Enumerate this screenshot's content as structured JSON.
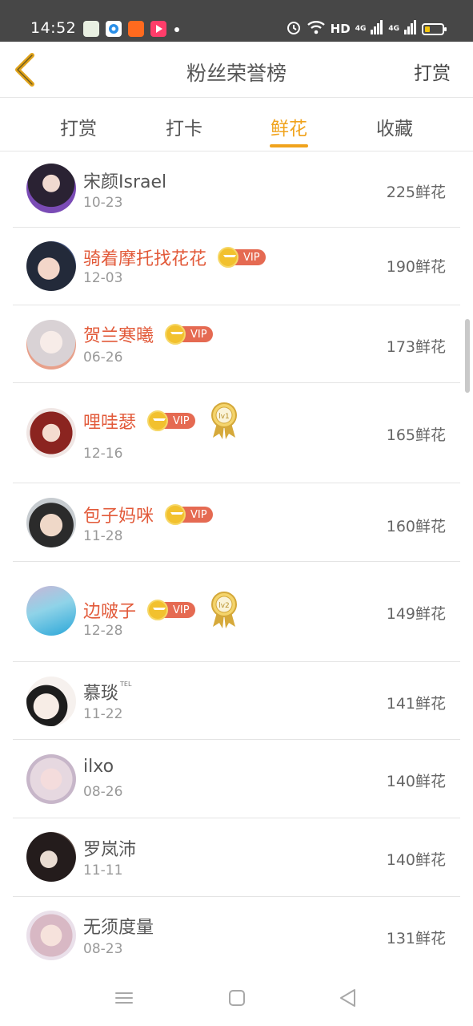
{
  "status_bar": {
    "time": "14:52",
    "network": "HD",
    "signal_1": "4G",
    "signal_2": "4G",
    "icons": [
      "app-notification-icon",
      "browser-icon",
      "app-icon",
      "video-app-icon",
      "alarm-icon",
      "wifi-icon",
      "battery-icon"
    ],
    "battery_level": 0.3
  },
  "header": {
    "title": "粉丝荣誉榜",
    "action": "打赏"
  },
  "tabs": [
    {
      "label": "打赏"
    },
    {
      "label": "打卡"
    },
    {
      "label": "鲜花"
    },
    {
      "label": "收藏"
    }
  ],
  "active_tab": "鲜花",
  "accent_color": "#f0a31c",
  "vip_label": "VIP",
  "fans": [
    {
      "name": "宋颜Israel",
      "date": "10-23",
      "amount": "225鲜花"
    },
    {
      "name": "骑着摩托找花花",
      "date": "12-03",
      "amount": "190鲜花"
    },
    {
      "name": "贺兰寒曦",
      "date": "06-26",
      "amount": "173鲜花"
    },
    {
      "name": "哩哇瑟",
      "date": "12-16",
      "amount": "165鲜花",
      "medal": "lv1"
    },
    {
      "name": "包子妈咪",
      "date": "11-28",
      "amount": "160鲜花"
    },
    {
      "name": "边啵子",
      "date": "12-28",
      "amount": "149鲜花",
      "medal": "lv2"
    },
    {
      "name": "慕琰",
      "tag": "TEL",
      "date": "11-22",
      "amount": "141鲜花"
    },
    {
      "name": "ilxo",
      "date": "08-26",
      "amount": "140鲜花"
    },
    {
      "name": "罗岚沛",
      "date": "11-11",
      "amount": "140鲜花"
    },
    {
      "name": "无须度量",
      "date": "08-23",
      "amount": "131鲜花"
    }
  ]
}
